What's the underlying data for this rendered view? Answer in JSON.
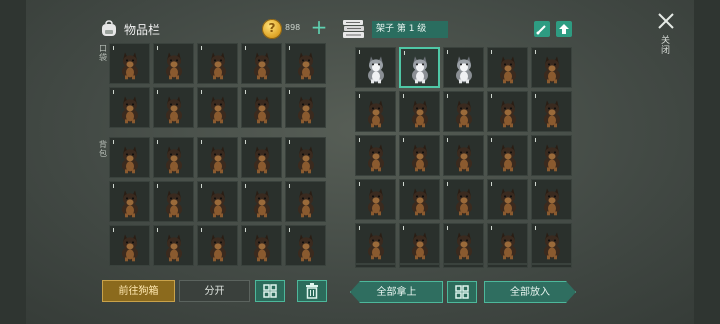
{
  "inventory": {
    "title": "物品栏",
    "coins": "898",
    "add_icon": "plus-icon",
    "sections": [
      {
        "label": "口袋",
        "rows": 2,
        "cols": 5
      },
      {
        "label": "背包",
        "rows": 3,
        "cols": 5
      }
    ],
    "slot_item": "dog-pet"
  },
  "shelf": {
    "level_label": "架子 第 1 级",
    "rows": 5,
    "cols": 5,
    "husky_slots": 3,
    "selected_slot": 1,
    "visible_rows": "5 full + partial 6th"
  },
  "close_label": "关闭",
  "buttons": {
    "goto": "前往狗箱",
    "split": "分开",
    "take_all": "全部拿上",
    "put_all": "全部放入"
  },
  "colors": {
    "accent": "#4fc7a6",
    "gold_button": "#8b6a1d",
    "teal_button": "#2f6e60"
  }
}
